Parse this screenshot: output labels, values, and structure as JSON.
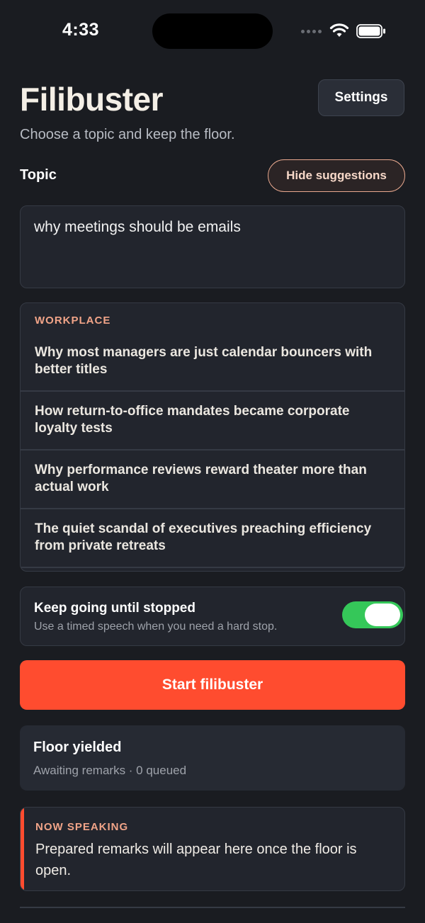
{
  "status_bar": {
    "time": "4:33"
  },
  "header": {
    "title": "Filibuster",
    "subtitle": "Choose a topic and keep the floor.",
    "settings_label": "Settings"
  },
  "topic": {
    "label": "Topic",
    "toggle_suggestions_label": "Hide suggestions",
    "input_value": "why meetings should be emails"
  },
  "suggestions": {
    "category": "WORKPLACE",
    "items": [
      "Why most managers are just calendar bouncers with better titles",
      "How return-to-office mandates became corporate loyalty tests",
      "Why performance reviews reward theater more than actual work",
      "The quiet scandal of executives preaching efficiency from private retreats"
    ]
  },
  "keep_going": {
    "title": "Keep going until stopped",
    "subtitle": "Use a timed speech when you need a hard stop.",
    "enabled": true
  },
  "start_button_label": "Start filibuster",
  "floor": {
    "title": "Floor yielded",
    "status": "Awaiting remarks · 0 queued"
  },
  "now_speaking": {
    "label": "NOW SPEAKING",
    "text": "Prepared remarks will appear here once the floor is open."
  },
  "colors": {
    "accent": "#ff4c2f",
    "toggle_on": "#35c759",
    "label_accent": "#f1a488",
    "background": "#1a1c21"
  }
}
